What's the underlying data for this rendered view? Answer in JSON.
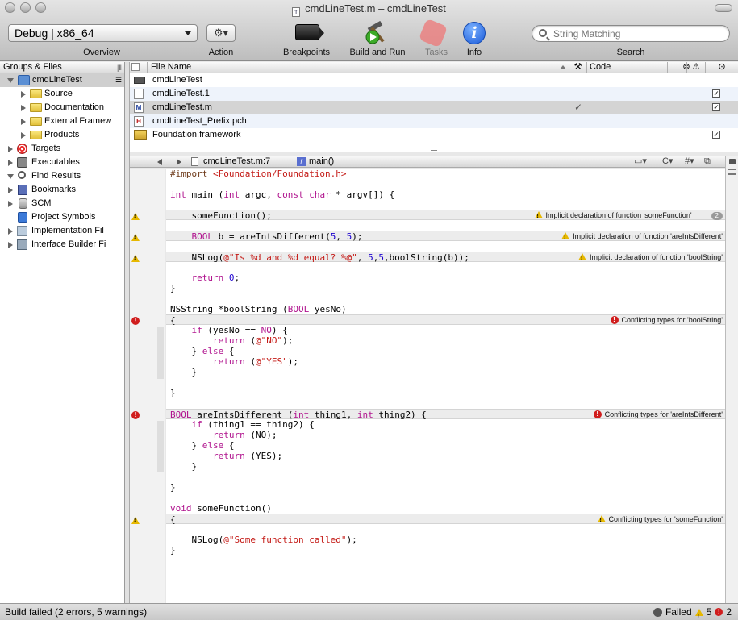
{
  "window": {
    "title": "cmdLineTest.m – cmdLineTest"
  },
  "toolbar": {
    "overview_value": "Debug | x86_64",
    "overview_label": "Overview",
    "action_label": "Action",
    "action_glyph": "⚙▾",
    "breakpoints_label": "Breakpoints",
    "build_run_label": "Build and Run",
    "tasks_label": "Tasks",
    "info_label": "Info",
    "info_glyph": "i",
    "search_placeholder": "String Matching",
    "search_label": "Search"
  },
  "sidebar": {
    "header": "Groups & Files",
    "items": [
      {
        "label": "cmdLineTest",
        "icon": "project-icon"
      },
      {
        "label": "Source",
        "icon": "folder-icon"
      },
      {
        "label": "Documentation",
        "icon": "folder-icon"
      },
      {
        "label": "External Framew",
        "icon": "folder-icon"
      },
      {
        "label": "Products",
        "icon": "folder-icon"
      },
      {
        "label": "Targets",
        "icon": "target-icon"
      },
      {
        "label": "Executables",
        "icon": "executable-icon"
      },
      {
        "label": "Find Results",
        "icon": "magnifier-icon"
      },
      {
        "label": "Bookmarks",
        "icon": "bookmark-icon"
      },
      {
        "label": "SCM",
        "icon": "scm-icon"
      },
      {
        "label": "Project Symbols",
        "icon": "symbols-icon"
      },
      {
        "label": "Implementation Fil",
        "icon": "implementation-icon"
      },
      {
        "label": "Interface Builder Fi",
        "icon": "interface-builder-icon"
      }
    ]
  },
  "detail": {
    "col_file_name": "File Name",
    "col_code": "Code",
    "files": [
      {
        "name": "cmdLineTest",
        "icon": "executable-file-icon",
        "checked": false
      },
      {
        "name": "cmdLineTest.1",
        "icon": "document-icon",
        "checked": true
      },
      {
        "name": "cmdLineTest.m",
        "icon": "m-file-icon",
        "checked": true
      },
      {
        "name": "cmdLineTest_Prefix.pch",
        "icon": "h-file-icon",
        "checked": false
      },
      {
        "name": "Foundation.framework",
        "icon": "framework-icon",
        "checked": true
      }
    ]
  },
  "editor": {
    "nav_file": "cmdLineTest.m:7",
    "nav_func": "main()",
    "nav_func_glyph": "f",
    "nav_right": [
      "#▾",
      "C▾"
    ],
    "messages": {
      "m1": "Implicit declaration of function 'someFunction'",
      "m1_count": "2",
      "m2": "Implicit declaration of function 'areIntsDifferent'",
      "m3": "Implicit declaration of function 'boolString'",
      "m4": "Conflicting types for 'boolString'",
      "m5": "Conflicting types for 'areIntsDifferent'",
      "m6": "Conflicting types for 'someFunction'"
    }
  },
  "status": {
    "text": "Build failed (2 errors, 5 warnings)",
    "result": "Failed",
    "warnings": "5",
    "errors": "2"
  },
  "colors": {
    "keyword": "#b0138e",
    "string": "#c41a16",
    "number": "#1c00cf",
    "warning": "#e6b800",
    "error": "#d01d1d"
  }
}
